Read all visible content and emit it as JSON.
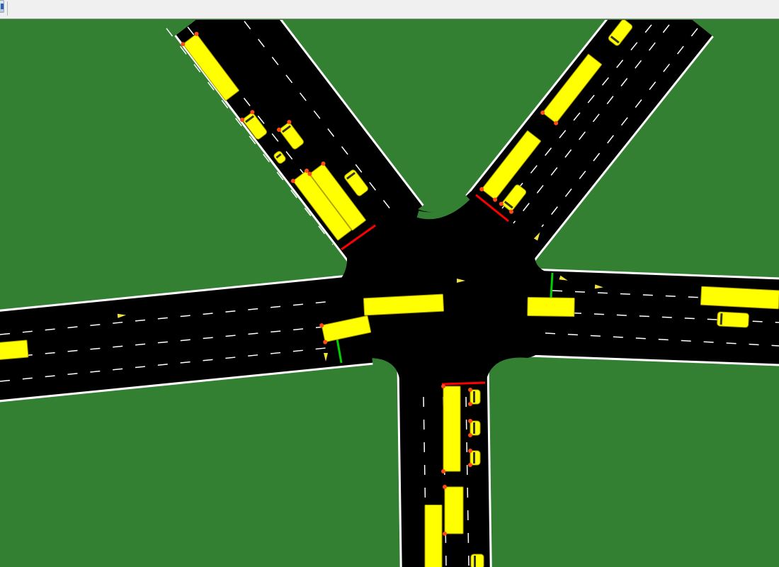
{
  "app": {
    "toolbar": {
      "button_icon": "app-icon"
    }
  },
  "scene": {
    "type": "traffic-intersection-simulation",
    "background": "#338033",
    "colors": {
      "grass": "#338033",
      "road": "#000000",
      "edge_line": "#ffffff",
      "lane_marking": "#ffffff",
      "vehicle": "#ffff00",
      "vehicle_outline": "#b0a000",
      "light_on": "#ff4a1a",
      "signal_red": "#ff0000",
      "signal_green": "#00d000",
      "pedestrian": "#f0e040"
    },
    "approaches": [
      {
        "name": "north-west",
        "signal": "red"
      },
      {
        "name": "north-east",
        "signal": "red"
      },
      {
        "name": "east",
        "signal": "green"
      },
      {
        "name": "south",
        "signal": "red"
      },
      {
        "name": "west",
        "signal": "green"
      }
    ],
    "vehicle_types": [
      "bus",
      "car"
    ]
  }
}
